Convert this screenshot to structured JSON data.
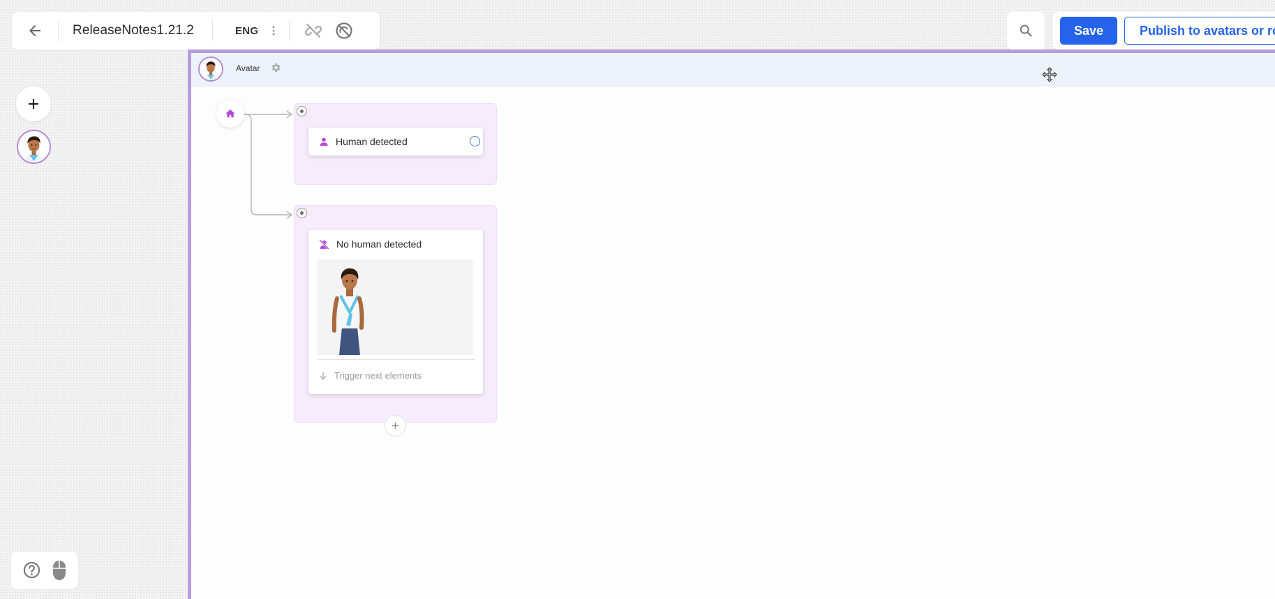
{
  "toolbar": {
    "project_name": "ReleaseNotes1.21.2",
    "language": "ENG",
    "icons": [
      "arrow-back-icon",
      "more-vertical-icon",
      "link-off-icon",
      "speed-off-icon"
    ]
  },
  "actions": {
    "save_label": "Save",
    "publish_label": "Publish to avatars or robots"
  },
  "canvas": {
    "header_name": "Avatar",
    "nodes": [
      {
        "label": "Human detected",
        "icon": "person-icon"
      },
      {
        "label": "No human detected",
        "icon": "person-off-icon",
        "footer": "Trigger next elements"
      }
    ]
  },
  "colors": {
    "accent": "#2563eb",
    "frame": "#b39ddb",
    "node_icon": "#b44ad9",
    "group_bg": "#f6ecfc",
    "header_bg": "#eef2fb"
  }
}
